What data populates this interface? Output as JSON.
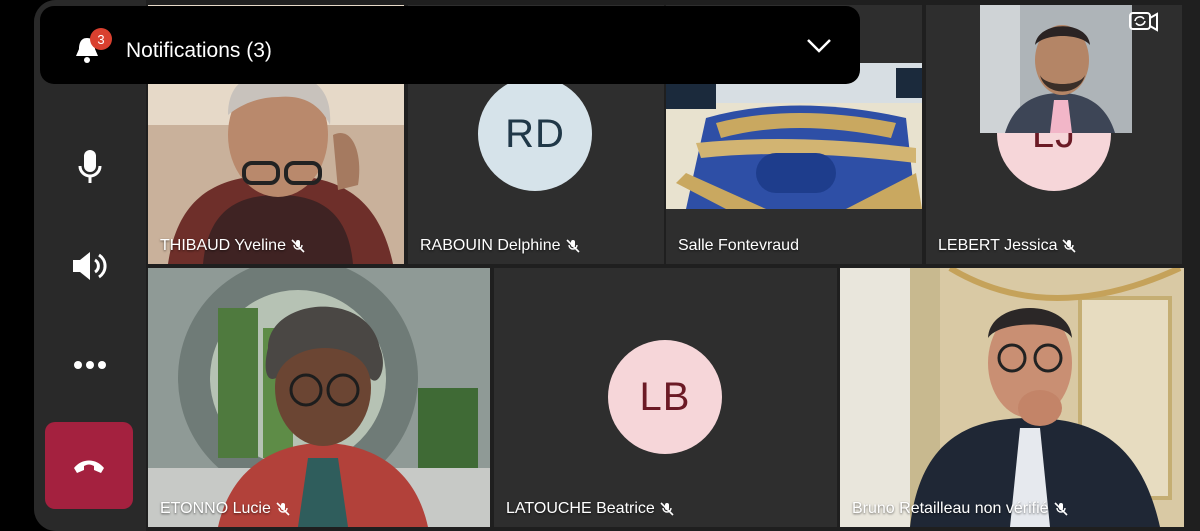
{
  "notification": {
    "title": "Notifications (3)",
    "badge_count": "3"
  },
  "rail": {
    "icons": [
      "microphone-icon",
      "speaker-icon",
      "more-options-icon",
      "hang-up-icon"
    ],
    "hangup_color": "#a4213f"
  },
  "participants": [
    {
      "name": "THIBAUD Yveline",
      "muted": true
    },
    {
      "name": "RABOUIN Delphine",
      "muted": true,
      "initials": "RD"
    },
    {
      "name": "Salle Fontevraud",
      "muted": false
    },
    {
      "name": "LEBERT Jessica",
      "muted": true,
      "initials": "LJ"
    },
    {
      "name": "ETONNO Lucie",
      "muted": true
    },
    {
      "name": "LATOUCHE Beatrice",
      "muted": true,
      "initials": "LB"
    },
    {
      "name": "Bruno Retailleau  non vérifié",
      "muted": true
    }
  ],
  "colors": {
    "background": "#1f1f1f",
    "tile": "#2e2e2e",
    "avatar_rd_bg": "#d6e3ea",
    "avatar_rd_fg": "#203848",
    "avatar_pink_bg": "#f6d6d9",
    "avatar_pink_fg": "#6b1a25",
    "badge": "#d9402f"
  }
}
